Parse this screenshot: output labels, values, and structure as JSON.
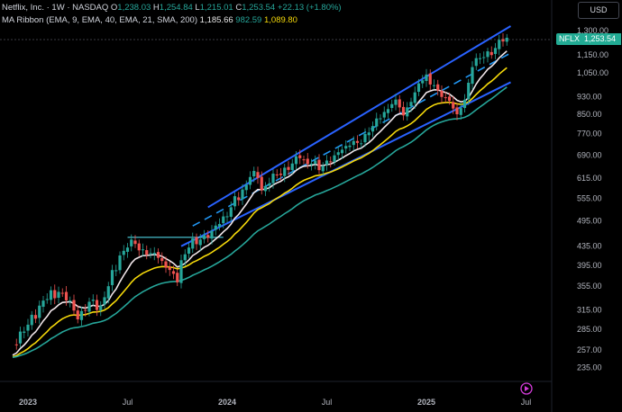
{
  "header": {
    "symbol_line": {
      "name": "Netflix, Inc. · 1W · NASDAQ",
      "o_label": "O",
      "o_value": "1,238.03",
      "h_label": "H",
      "h_value": "1,254.84",
      "l_label": "L",
      "l_value": "1,215.01",
      "c_label": "C",
      "c_value": "1,253.54",
      "change": "+22.13 (+1.80%)"
    },
    "indicator_line": {
      "name": "MA Ribbon (EMA, 9, EMA, 40, EMA, 21, SMA, 200)",
      "v1": "1,185.66",
      "v2": "982.59",
      "v3": "1,089.80"
    }
  },
  "currency_button": "USD",
  "last_price": {
    "symbol": "NFLX",
    "price": "1,253.54"
  },
  "colors": {
    "up": "#26a69a",
    "down": "#ef5350",
    "ema9": "#f0e6ea",
    "ema21": "#f5d90a",
    "ema40": "#26a69a",
    "channel": "#2962ff",
    "dashed": "#2196f3",
    "resistance": "#4dd0e1"
  },
  "chart_data": {
    "type": "candlestick",
    "y_scale": "log",
    "ylim": [
      225,
      1330
    ],
    "y_ticks": [
      {
        "value": 1300,
        "label": "1,300.00"
      },
      {
        "value": 1150,
        "label": "1,150.00"
      },
      {
        "value": 1050,
        "label": "1,050.00"
      },
      {
        "value": 930,
        "label": "930.00"
      },
      {
        "value": 850,
        "label": "850.00"
      },
      {
        "value": 770,
        "label": "770.00"
      },
      {
        "value": 690,
        "label": "690.00"
      },
      {
        "value": 615,
        "label": "615.00"
      },
      {
        "value": 555,
        "label": "555.00"
      },
      {
        "value": 495,
        "label": "495.00"
      },
      {
        "value": 435,
        "label": "435.00"
      },
      {
        "value": 395,
        "label": "395.00"
      },
      {
        "value": 355,
        "label": "355.00"
      },
      {
        "value": 315,
        "label": "315.00"
      },
      {
        "value": 285,
        "label": "285.00"
      },
      {
        "value": 257,
        "label": "257.00"
      },
      {
        "value": 235,
        "label": "235.00"
      }
    ],
    "x_ticks": [
      {
        "week": 0,
        "label": "2023"
      },
      {
        "week": 26,
        "label": "Jul"
      },
      {
        "week": 52,
        "label": "2024"
      },
      {
        "week": 78,
        "label": "Jul"
      },
      {
        "week": 104,
        "label": "2025"
      },
      {
        "week": 130,
        "label": "Jul"
      }
    ],
    "close_waypoints": [
      [
        -4,
        265
      ],
      [
        0,
        292
      ],
      [
        4,
        330
      ],
      [
        8,
        345
      ],
      [
        11,
        330
      ],
      [
        13,
        300
      ],
      [
        16,
        328
      ],
      [
        19,
        322
      ],
      [
        21,
        355
      ],
      [
        24,
        415
      ],
      [
        26,
        432
      ],
      [
        28,
        440
      ],
      [
        30,
        428
      ],
      [
        32,
        420
      ],
      [
        34,
        410
      ],
      [
        36,
        390
      ],
      [
        38,
        378
      ],
      [
        39,
        362
      ],
      [
        40,
        405
      ],
      [
        42,
        432
      ],
      [
        45,
        450
      ],
      [
        48,
        470
      ],
      [
        50,
        487
      ],
      [
        53,
        530
      ],
      [
        56,
        580
      ],
      [
        58,
        618
      ],
      [
        60,
        615
      ],
      [
        61,
        578
      ],
      [
        63,
        598
      ],
      [
        65,
        625
      ],
      [
        67,
        648
      ],
      [
        69,
        662
      ],
      [
        71,
        680
      ],
      [
        73,
        660
      ],
      [
        75,
        672
      ],
      [
        76,
        640
      ],
      [
        78,
        672
      ],
      [
        80,
        690
      ],
      [
        82,
        710
      ],
      [
        84,
        725
      ],
      [
        86,
        735
      ],
      [
        89,
        775
      ],
      [
        91,
        832
      ],
      [
        93,
        860
      ],
      [
        95,
        895
      ],
      [
        97,
        880
      ],
      [
        98,
        845
      ],
      [
        100,
        905
      ],
      [
        101,
        950
      ],
      [
        103,
        1010
      ],
      [
        104,
        1040
      ],
      [
        106,
        985
      ],
      [
        107,
        960
      ],
      [
        108,
        928
      ],
      [
        110,
        910
      ],
      [
        111,
        875
      ],
      [
        112,
        850
      ],
      [
        114,
        915
      ],
      [
        116,
        1080
      ],
      [
        118,
        1130
      ],
      [
        120,
        1170
      ],
      [
        122,
        1190
      ],
      [
        124,
        1230
      ],
      [
        125,
        1253.54
      ]
    ],
    "series": [
      {
        "type": "ema",
        "length": 9
      },
      {
        "type": "ema",
        "length": 21
      },
      {
        "type": "ema",
        "length": 40
      }
    ],
    "drawings": {
      "channel_upper": [
        [
          47,
          530
        ],
        [
          126,
          1330
        ]
      ],
      "channel_lower": [
        [
          40,
          435
        ],
        [
          126,
          1000
        ]
      ],
      "channel_mid_dashed": [
        [
          43,
          482
        ],
        [
          126,
          1160
        ]
      ],
      "resistance": [
        [
          26,
          455
        ],
        [
          51,
          455
        ]
      ]
    }
  }
}
